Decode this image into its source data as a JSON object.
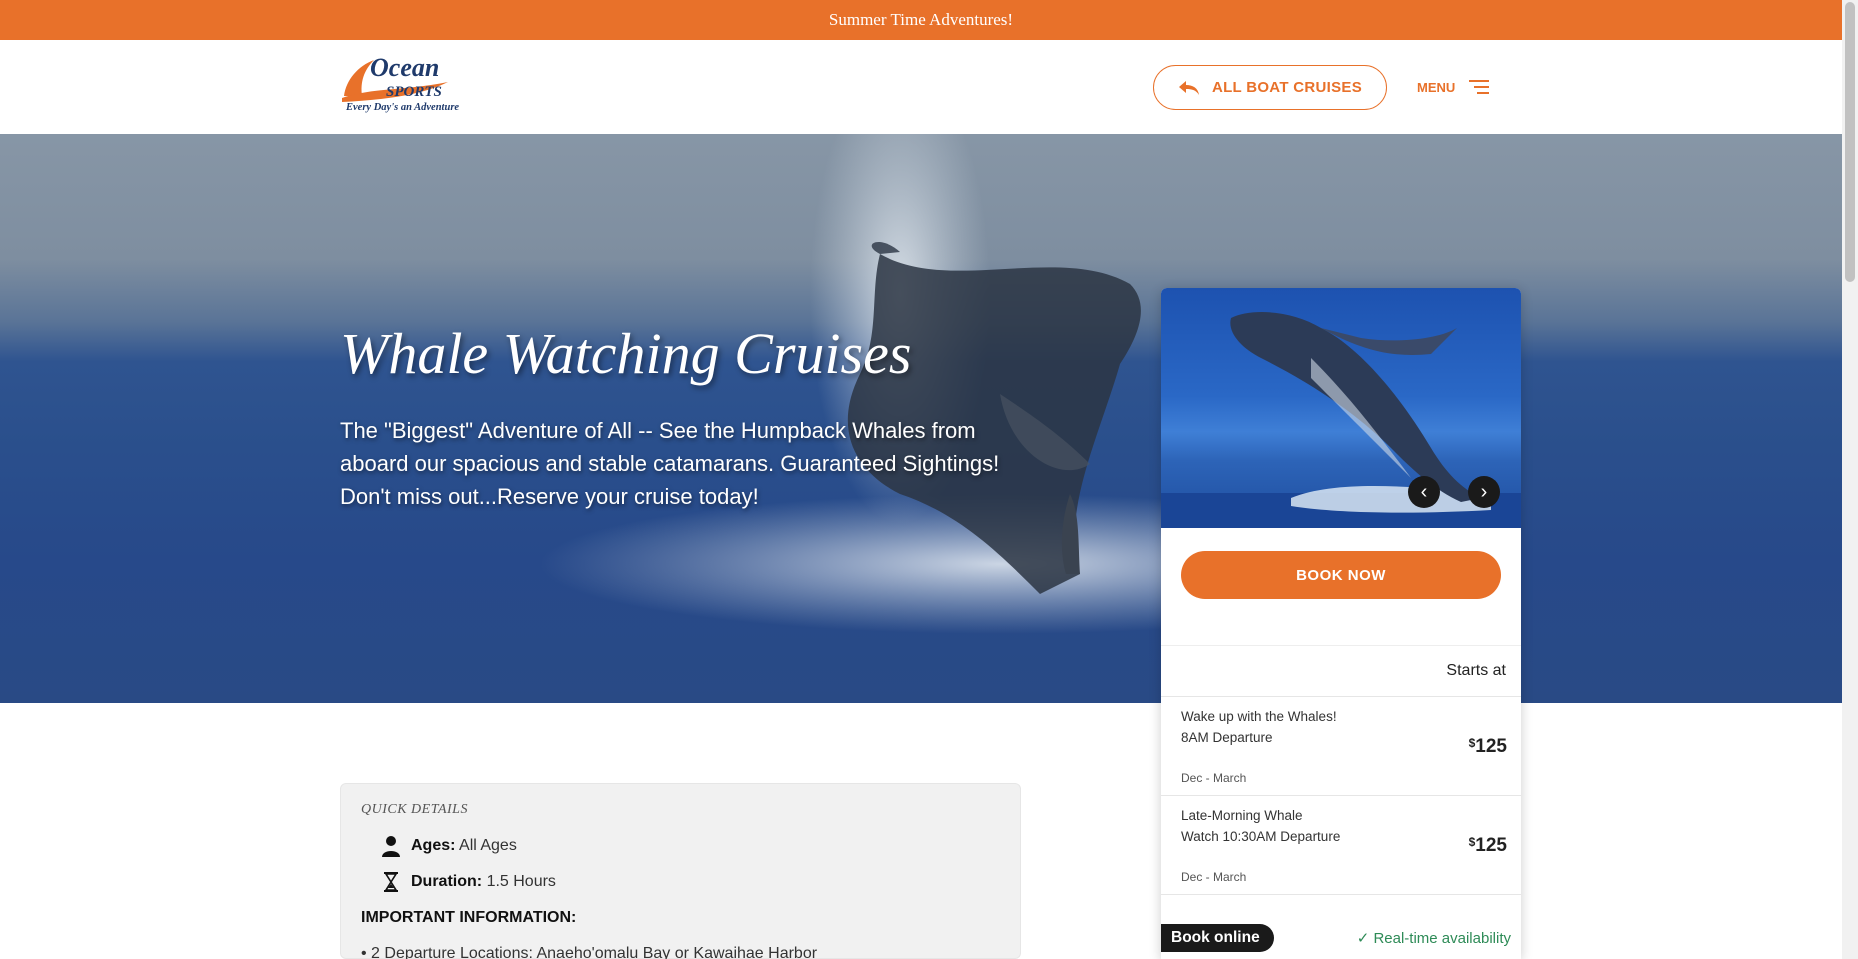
{
  "announcement": "Summer Time Adventures!",
  "logo": {
    "wordmark_top": "Ocean",
    "wordmark_bottom": "SPORTS",
    "tagline": "Every Day's an Adventure"
  },
  "header": {
    "all_cruises_label": "ALL BOAT CRUISES",
    "menu_label": "MENU"
  },
  "hero": {
    "title": "Whale Watching Cruises",
    "subtitle": "The \"Biggest\" Adventure of All -- See the Humpback Whales from aboard our spacious and stable catamarans. Guaranteed Sightings! Don't miss out...Reserve your cruise today!"
  },
  "booking": {
    "book_now": "BOOK NOW",
    "starts_at": "Starts at",
    "options": [
      {
        "name": "Wake up with the Whales! 8AM Departure",
        "season": "Dec - March",
        "currency": "$",
        "price": "125"
      },
      {
        "name": "Late-Morning Whale Watch 10:30AM Departure",
        "season": "Dec - March",
        "currency": "$",
        "price": "125"
      }
    ],
    "book_online": "Book online",
    "realtime": "Real-time availability"
  },
  "details": {
    "label": "QUICK DETAILS",
    "ages_label": "Ages:",
    "ages_value": "All Ages",
    "duration_label": "Duration:",
    "duration_value": "1.5 Hours",
    "important": "IMPORTANT INFORMATION:",
    "bullet1": "2 Departure Locations: Anaeho'omalu Bay or Kawaihae Harbor"
  },
  "colors": {
    "accent": "#e8712a",
    "navy": "#1f3a6b",
    "check": "#2e8b57"
  },
  "icons": [
    "back-arrow-icon",
    "hamburger-icon",
    "chevron-left-icon",
    "chevron-right-icon",
    "person-icon",
    "hourglass-icon",
    "check-icon"
  ]
}
